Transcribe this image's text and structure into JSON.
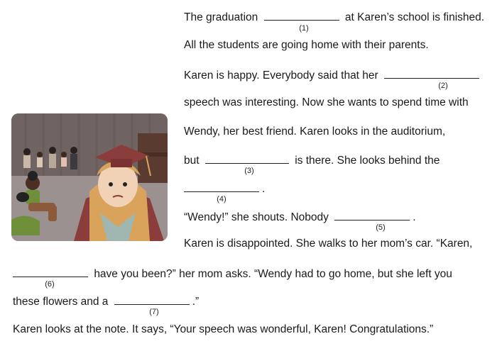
{
  "story": {
    "l1_a": "The graduation",
    "l1_b": "at Karen’s school is finished.",
    "n1": "(1)",
    "l2": "All the students are going home with their parents.",
    "l3": "Karen is happy. Everybody said that her",
    "n2": "(2)",
    "l4": "speech was interesting. Now she wants to spend time with",
    "l5": "Wendy, her best friend. Karen looks in the auditorium,",
    "l6_a": "but",
    "l6_b": "is there. She looks behind the",
    "n3": "(3)",
    "l7_b": ".",
    "n4": "(4)",
    "l8_a": "“Wendy!” she shouts. Nobody",
    "l8_b": ".",
    "n5": "(5)",
    "l9": "Karen is disappointed. She walks to her mom’s car. “Karen,",
    "l10_b": "have you been?” her mom asks. “Wendy had to go home, but she left you",
    "n6": "(6)",
    "l11_a": "these flowers and a",
    "l11_b": ".”",
    "n7": "(7)",
    "l12": "Karen looks at the note. It says, “Your speech was wonderful, Karen! Congratulations.”"
  },
  "illustration": {
    "icon": "graduation-scene-illustration",
    "colors": {
      "background": "#7a6f6d",
      "floor": "#9a9190",
      "gown": "#8a3d3a",
      "hair": "#d9a35c",
      "skin": "#f2d2b6",
      "boy_shirt": "#6f8f3a",
      "boy_pants": "#8a5a3a"
    }
  }
}
